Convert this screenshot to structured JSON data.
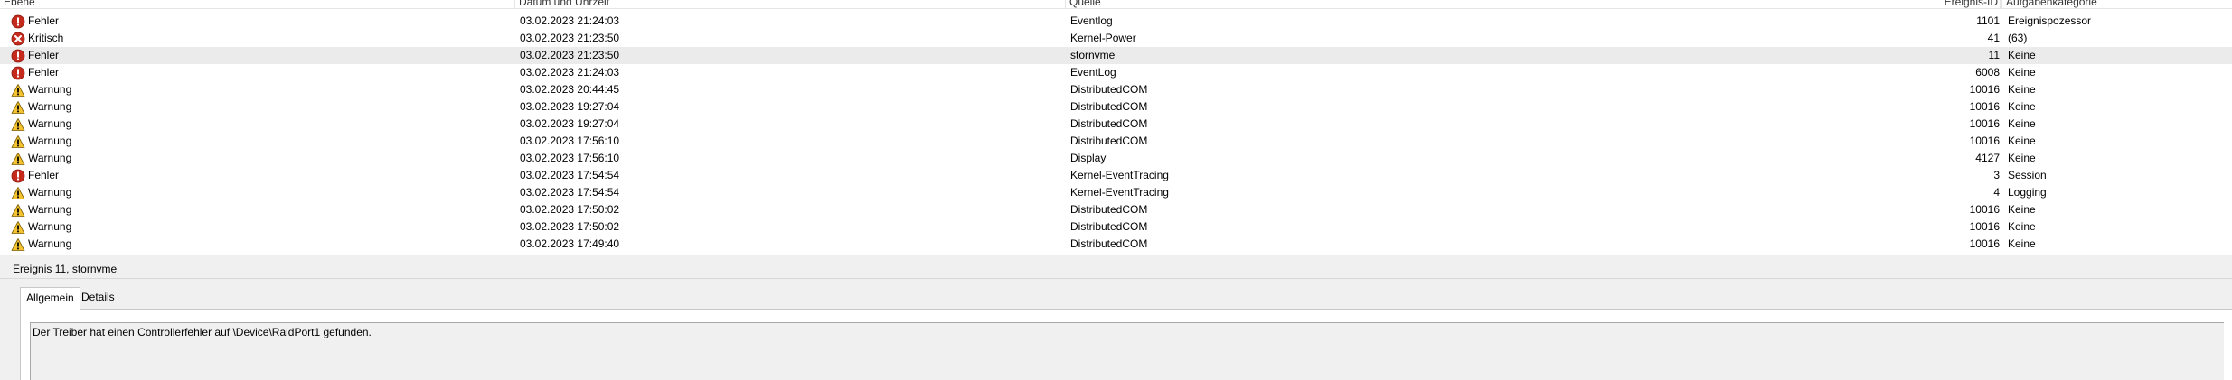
{
  "list": {
    "headers": {
      "level": "Ebene",
      "date": "Datum und Uhrzeit",
      "source": "Quelle",
      "id": "Ereignis-ID",
      "task": "Aufgabenkategorie"
    },
    "rows": [
      {
        "level": "Fehler",
        "icon": "error-icon",
        "date": "03.02.2023 21:24:03",
        "source": "Eventlog",
        "id": "1101",
        "task": "Ereignispozessor",
        "selected": false
      },
      {
        "level": "Kritisch",
        "icon": "critical-icon",
        "date": "03.02.2023 21:23:50",
        "source": "Kernel-Power",
        "id": "41",
        "task": "(63)",
        "selected": false
      },
      {
        "level": "Fehler",
        "icon": "error-icon",
        "date": "03.02.2023 21:23:50",
        "source": "stornvme",
        "id": "11",
        "task": "Keine",
        "selected": true
      },
      {
        "level": "Fehler",
        "icon": "error-icon",
        "date": "03.02.2023 21:24:03",
        "source": "EventLog",
        "id": "6008",
        "task": "Keine",
        "selected": false
      },
      {
        "level": "Warnung",
        "icon": "warning-icon",
        "date": "03.02.2023 20:44:45",
        "source": "DistributedCOM",
        "id": "10016",
        "task": "Keine",
        "selected": false
      },
      {
        "level": "Warnung",
        "icon": "warning-icon",
        "date": "03.02.2023 19:27:04",
        "source": "DistributedCOM",
        "id": "10016",
        "task": "Keine",
        "selected": false
      },
      {
        "level": "Warnung",
        "icon": "warning-icon",
        "date": "03.02.2023 19:27:04",
        "source": "DistributedCOM",
        "id": "10016",
        "task": "Keine",
        "selected": false
      },
      {
        "level": "Warnung",
        "icon": "warning-icon",
        "date": "03.02.2023 17:56:10",
        "source": "DistributedCOM",
        "id": "10016",
        "task": "Keine",
        "selected": false
      },
      {
        "level": "Warnung",
        "icon": "warning-icon",
        "date": "03.02.2023 17:56:10",
        "source": "Display",
        "id": "4127",
        "task": "Keine",
        "selected": false
      },
      {
        "level": "Fehler",
        "icon": "error-icon",
        "date": "03.02.2023 17:54:54",
        "source": "Kernel-EventTracing",
        "id": "3",
        "task": "Session",
        "selected": false
      },
      {
        "level": "Warnung",
        "icon": "warning-icon",
        "date": "03.02.2023 17:54:54",
        "source": "Kernel-EventTracing",
        "id": "4",
        "task": "Logging",
        "selected": false
      },
      {
        "level": "Warnung",
        "icon": "warning-icon",
        "date": "03.02.2023 17:50:02",
        "source": "DistributedCOM",
        "id": "10016",
        "task": "Keine",
        "selected": false
      },
      {
        "level": "Warnung",
        "icon": "warning-icon",
        "date": "03.02.2023 17:50:02",
        "source": "DistributedCOM",
        "id": "10016",
        "task": "Keine",
        "selected": false
      },
      {
        "level": "Warnung",
        "icon": "warning-icon",
        "date": "03.02.2023 17:49:40",
        "source": "DistributedCOM",
        "id": "10016",
        "task": "Keine",
        "selected": false
      }
    ]
  },
  "detail": {
    "title": "Ereignis 11, stornvme",
    "tabs": {
      "general": "Allgemein",
      "details": "Details"
    },
    "active_tab": "Allgemein",
    "message": "Der Treiber hat einen Controllerfehler auf \\Device\\RaidPort1 gefunden."
  },
  "colors": {
    "error": "#c42b1c",
    "critical": "#c42b1c",
    "warning": "#f4c430",
    "selected_row": "#ebebeb"
  }
}
